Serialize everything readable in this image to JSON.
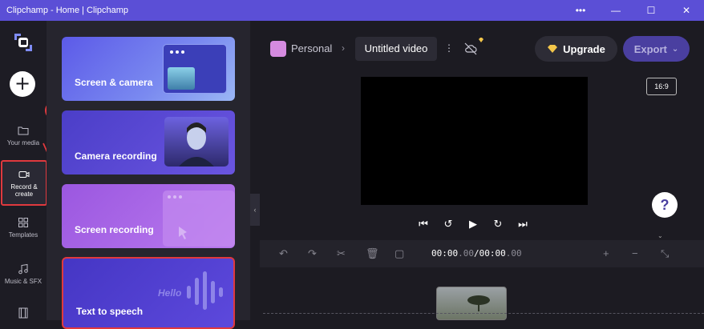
{
  "window": {
    "title": "Clipchamp - Home | Clipchamp",
    "controls": {
      "more": "•••",
      "minimize": "—",
      "maximize": "☐",
      "close": "✕"
    }
  },
  "rail": {
    "add_label": "+",
    "items": [
      {
        "label": "Your media",
        "icon": "folder-icon"
      },
      {
        "label": "Record & create",
        "icon": "video-camera-icon",
        "active": true
      },
      {
        "label": "Templates",
        "icon": "templates-icon"
      },
      {
        "label": "Music & SFX",
        "icon": "music-icon"
      },
      {
        "label": "",
        "icon": "film-icon"
      }
    ],
    "annotation_number": "1"
  },
  "panel": {
    "cards": [
      {
        "label": "Screen & camera"
      },
      {
        "label": "Camera recording"
      },
      {
        "label": "Screen recording"
      },
      {
        "label": "Text to speech",
        "decor_text": "Hello"
      }
    ]
  },
  "topbar": {
    "workspace": "Personal",
    "separator": "›",
    "project_title": "Untitled video",
    "upgrade_label": "Upgrade",
    "export_label": "Export"
  },
  "preview": {
    "aspect_ratio": "16:9",
    "help_label": "?"
  },
  "timeline": {
    "current_time_main": "00:00",
    "current_time_ms": ".00",
    "slash": "/",
    "total_time_main": "00:00",
    "total_time_ms": ".00"
  },
  "colors": {
    "titlebar": "#5b4fd6",
    "accent": "#4a3fa0",
    "highlight": "#e0393e",
    "background": "#1c1b22"
  }
}
